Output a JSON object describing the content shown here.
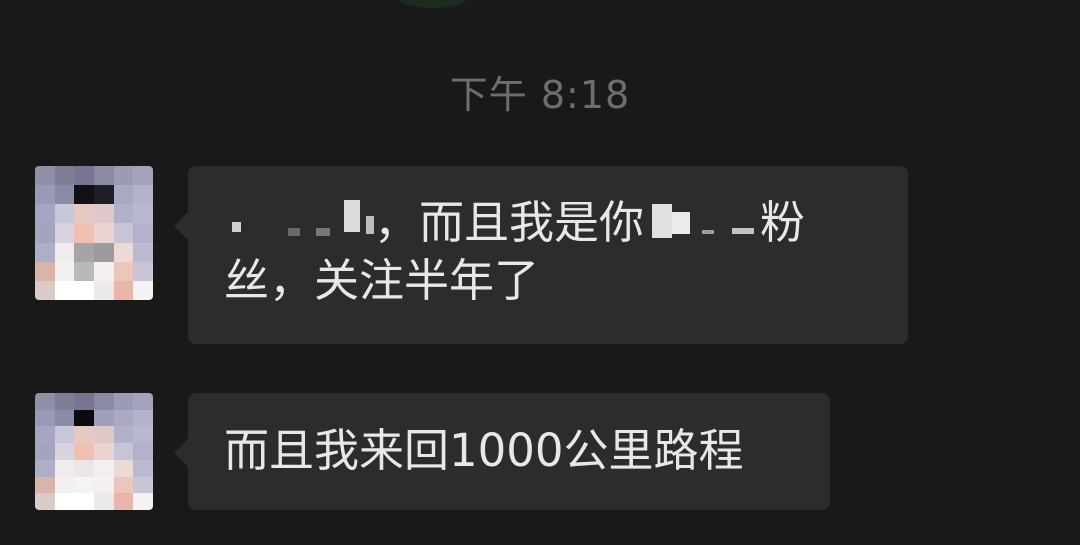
{
  "chat": {
    "timestamp": "下午 8:18",
    "messages": [
      {
        "sender": "other",
        "text_after_redaction": "，而且我是你",
        "text_tail": "粉丝，关注半年了"
      },
      {
        "sender": "other",
        "text": "而且我来回1000公里路程"
      }
    ]
  },
  "colors": {
    "background": "#191919",
    "bubble": "#2c2c2c",
    "text": "#e8e8e8",
    "timestamp": "#6e6e6e"
  }
}
